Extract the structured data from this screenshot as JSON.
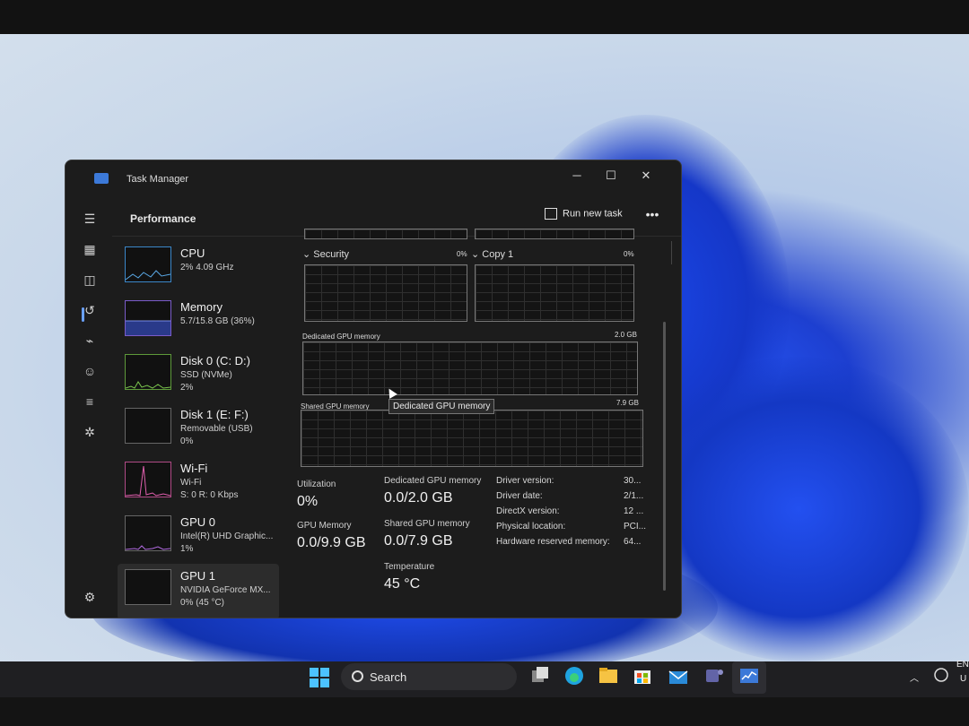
{
  "window": {
    "title": "Task Manager",
    "minimize": "─",
    "maximize": "☐",
    "close": "✕"
  },
  "header": {
    "title": "Performance",
    "run_new_task": "Run new task",
    "more": "•••"
  },
  "devices": [
    {
      "name": "CPU",
      "line1": "2% 4.09 GHz",
      "line2": ""
    },
    {
      "name": "Memory",
      "line1": "5.7/15.8 GB (36%)",
      "line2": ""
    },
    {
      "name": "Disk 0 (C: D:)",
      "line1": "SSD (NVMe)",
      "line2": "2%"
    },
    {
      "name": "Disk 1 (E: F:)",
      "line1": "Removable (USB)",
      "line2": "0%"
    },
    {
      "name": "Wi-Fi",
      "line1": "Wi-Fi",
      "line2": "S: 0 R: 0 Kbps"
    },
    {
      "name": "GPU 0",
      "line1": "Intel(R) UHD Graphic...",
      "line2": "1%"
    },
    {
      "name": "GPU 1",
      "line1": "NVIDIA GeForce MX...",
      "line2": "0% (45 °C)"
    }
  ],
  "graphs": {
    "security": {
      "label": "Security",
      "pct": "0%"
    },
    "copy1": {
      "label": "Copy 1",
      "pct": "0%"
    },
    "dedicated": {
      "label": "Dedicated GPU memory",
      "max": "2.0 GB"
    },
    "shared": {
      "label": "Shared GPU memory",
      "max": "7.9 GB"
    },
    "tooltip": "Dedicated GPU memory"
  },
  "stats": {
    "utilization_label": "Utilization",
    "utilization_value": "0%",
    "gpu_memory_label": "GPU Memory",
    "gpu_memory_value": "0.0/9.9 GB",
    "dedicated_label": "Dedicated GPU memory",
    "dedicated_value": "0.0/2.0 GB",
    "shared_label": "Shared GPU memory",
    "shared_value": "0.0/7.9 GB",
    "temperature_label": "Temperature",
    "temperature_value": "45 °C"
  },
  "properties": [
    {
      "label": "Driver version:",
      "value": "30..."
    },
    {
      "label": "Driver date:",
      "value": "2/1..."
    },
    {
      "label": "DirectX version:",
      "value": "12 ..."
    },
    {
      "label": "Physical location:",
      "value": "PCI..."
    },
    {
      "label": "Hardware reserved memory:",
      "value": "64..."
    }
  ],
  "taskbar": {
    "search": "Search",
    "tray_lang": "EN",
    "tray_region": "U"
  }
}
